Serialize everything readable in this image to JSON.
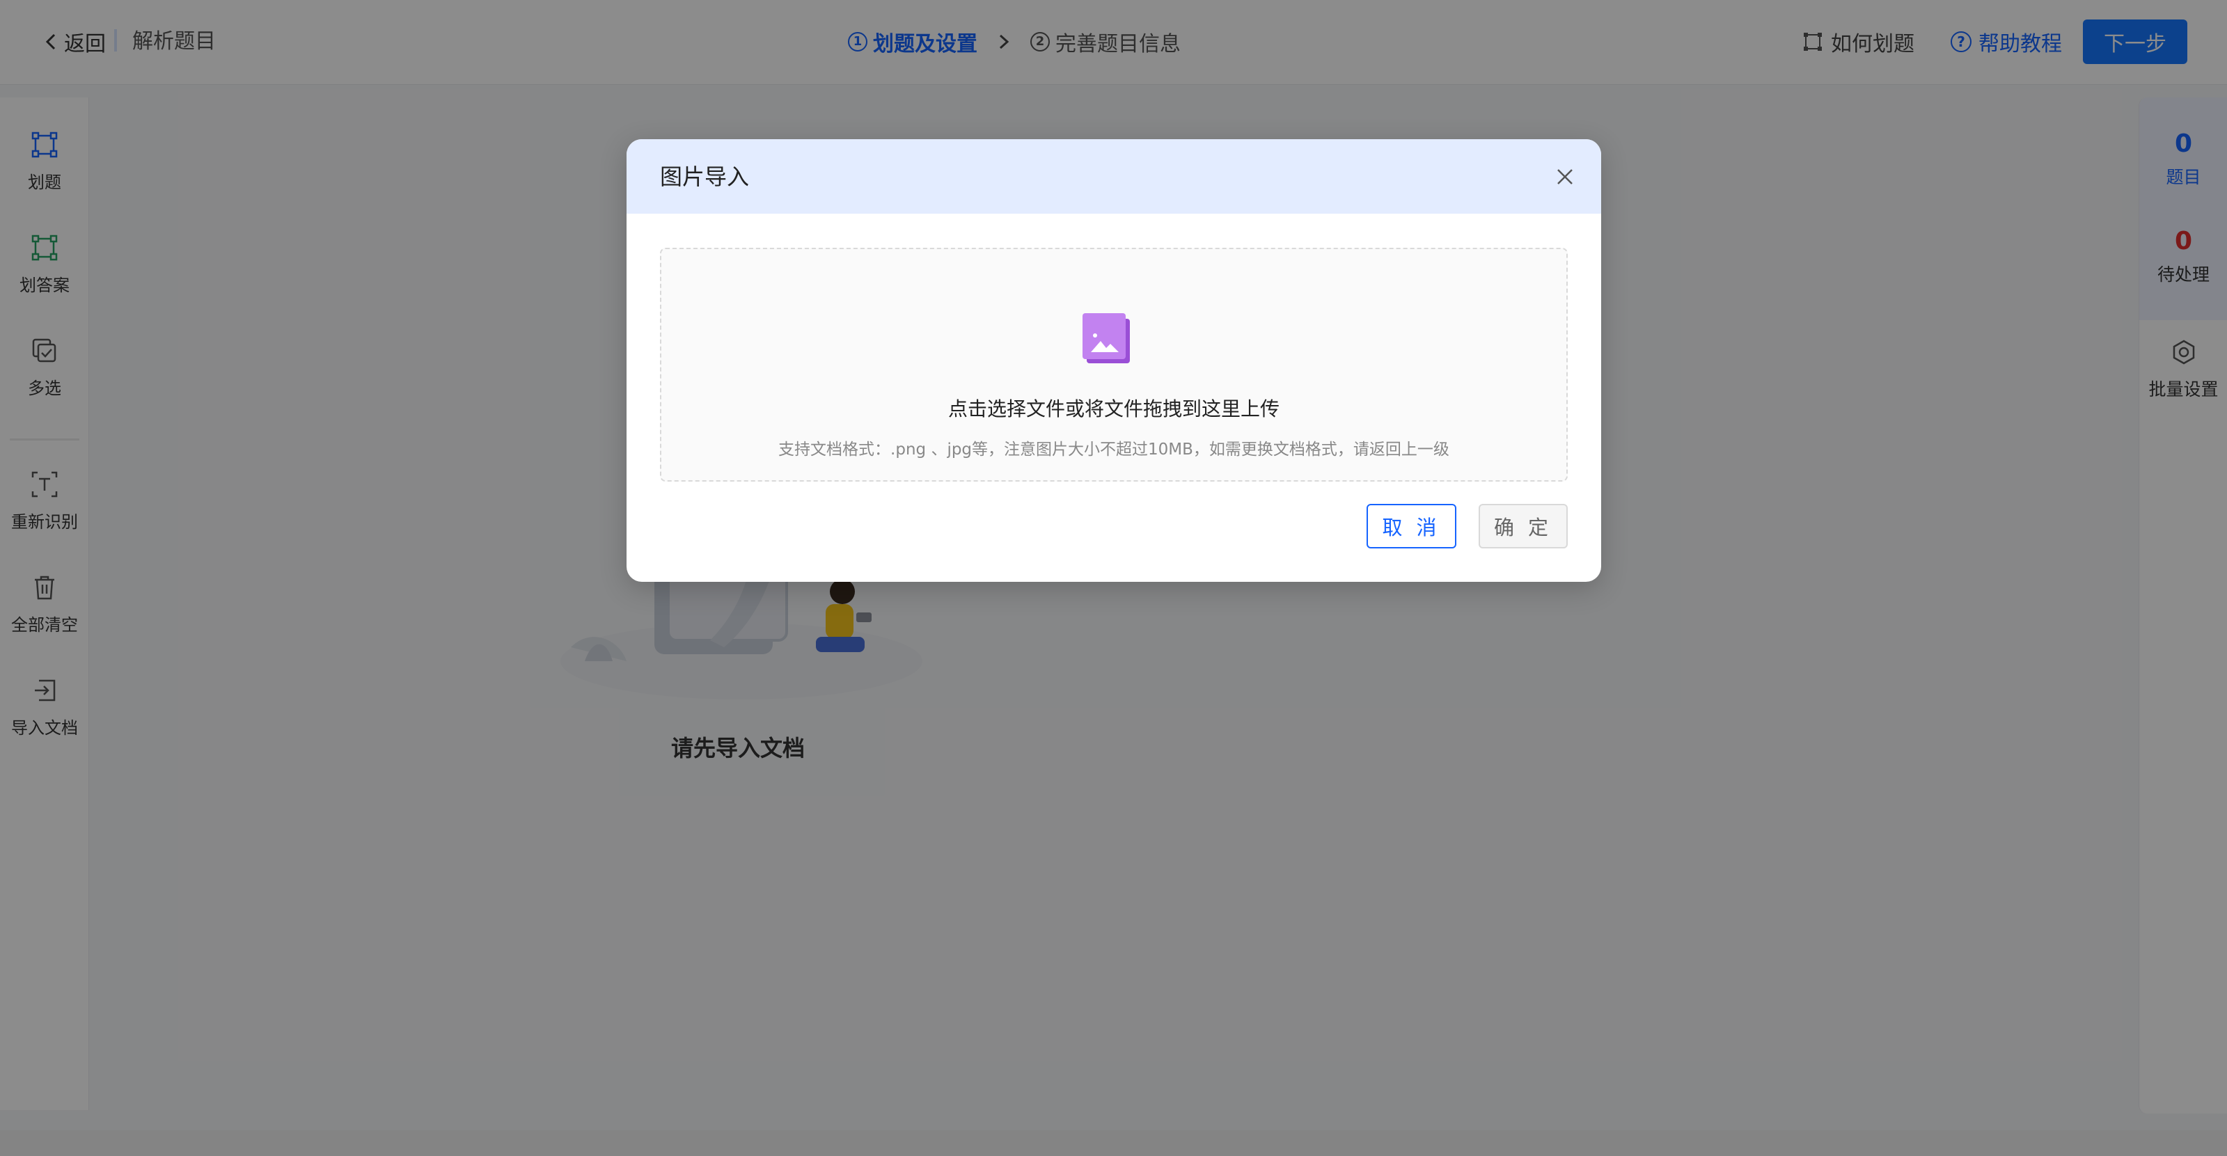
{
  "header": {
    "back_label": "返回",
    "title": "解析题目",
    "steps": [
      {
        "num": "1",
        "label": "划题及设置"
      },
      {
        "num": "2",
        "label": "完善题目信息"
      }
    ],
    "how_to_label": "如何划题",
    "help_icon": "?",
    "help_label": "帮助教程",
    "next_label": "下一步"
  },
  "toolbar": {
    "items": [
      {
        "label": "划题",
        "icon": "select-box-icon",
        "color": "#1664ff"
      },
      {
        "label": "划答案",
        "icon": "select-answer-icon",
        "color": "#27a365"
      },
      {
        "label": "多选",
        "icon": "multi-select-icon"
      },
      {
        "label": "重新识别",
        "icon": "text-recognize-icon"
      },
      {
        "label": "全部清空",
        "icon": "trash-icon"
      },
      {
        "label": "导入文档",
        "icon": "import-icon"
      }
    ]
  },
  "right_panel": {
    "questions_count": "0",
    "questions_label": "题目",
    "pending_count": "0",
    "pending_label": "待处理",
    "batch_label": "批量设置"
  },
  "main": {
    "empty_text": "请先导入文档"
  },
  "modal": {
    "title": "图片导入",
    "drop_main": "点击选择文件或将文件拖拽到这里上传",
    "drop_hint": "支持文档格式：.png 、jpg等，注意图片大小不超过10MB，如需更换文档格式，请返回上一级",
    "cancel_label": "取 消",
    "ok_label": "确 定"
  },
  "colors": {
    "primary": "#1664ff",
    "answer_green": "#27a365",
    "pending_red": "#e02f2f",
    "modal_header": "#e3ecff"
  }
}
